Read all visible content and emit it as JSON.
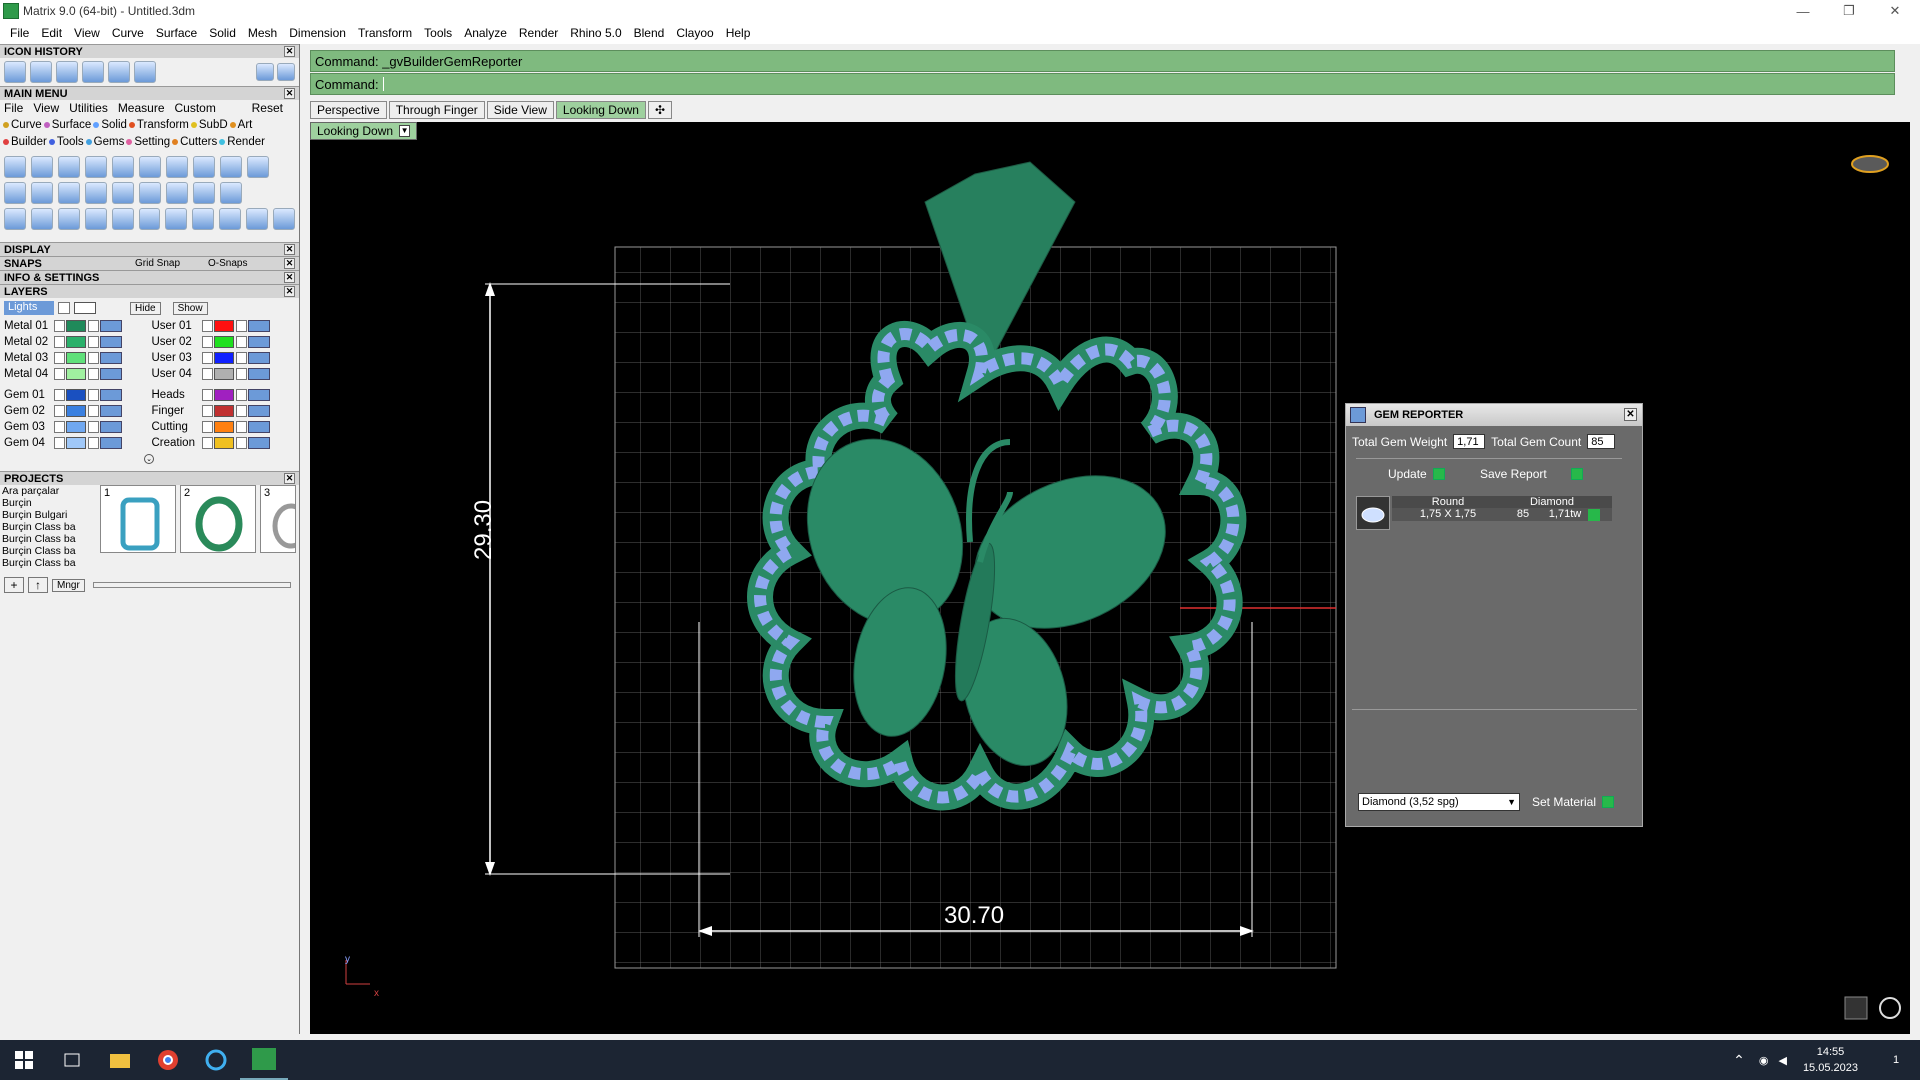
{
  "window": {
    "title": "Matrix 9.0 (64-bit) - Untitled.3dm",
    "min": "—",
    "restore": "❐",
    "close": "✕"
  },
  "menubar": [
    "File",
    "Edit",
    "View",
    "Curve",
    "Surface",
    "Solid",
    "Mesh",
    "Dimension",
    "Transform",
    "Tools",
    "Analyze",
    "Render",
    "Rhino 5.0",
    "Blend",
    "Clayoo",
    "Help"
  ],
  "panels": {
    "icon_history": "ICON HISTORY",
    "main_menu": "MAIN MENU",
    "display": "DISPLAY",
    "snaps": "SNAPS",
    "grid_snap": "Grid Snap",
    "osnaps": "O-Snaps",
    "info": "INFO & SETTINGS",
    "layers": "LAYERS",
    "projects": "PROJECTS"
  },
  "main_menu": {
    "tabs": [
      "File",
      "View",
      "Utilities",
      "Measure",
      "Custom"
    ],
    "reset": "Reset",
    "row1": [
      {
        "label": "Curve",
        "color": "#d0a020"
      },
      {
        "label": "Surface",
        "color": "#c060c0"
      },
      {
        "label": "Solid",
        "color": "#60a0ff"
      },
      {
        "label": "Transform",
        "color": "#e05020"
      },
      {
        "label": "SubD",
        "color": "#e0c020"
      },
      {
        "label": "Art",
        "color": "#e09020"
      }
    ],
    "row2": [
      {
        "label": "Builder",
        "color": "#e04040"
      },
      {
        "label": "Tools",
        "color": "#4060e0"
      },
      {
        "label": "Gems",
        "color": "#40a0e0"
      },
      {
        "label": "Setting",
        "color": "#e060a0"
      },
      {
        "label": "Cutters",
        "color": "#e08020"
      },
      {
        "label": "Render",
        "color": "#40c0e0"
      }
    ]
  },
  "layers": {
    "lights": "Lights",
    "hide": "Hide",
    "show": "Show",
    "left": [
      {
        "name": "Metal 01",
        "color": "#1f8a5a"
      },
      {
        "name": "Metal 02",
        "color": "#2ab06a"
      },
      {
        "name": "Metal 03",
        "color": "#5fe07a"
      },
      {
        "name": "Metal 04",
        "color": "#a0f0a0"
      },
      {
        "name": "Gem 01",
        "color": "#1a50c0"
      },
      {
        "name": "Gem 02",
        "color": "#3a80e0"
      },
      {
        "name": "Gem 03",
        "color": "#70a8f0"
      },
      {
        "name": "Gem 04",
        "color": "#a0c8f8"
      }
    ],
    "right": [
      {
        "name": "User 01",
        "color": "#ff1010"
      },
      {
        "name": "User 02",
        "color": "#20e020"
      },
      {
        "name": "User 03",
        "color": "#1020ff"
      },
      {
        "name": "User 04",
        "color": "#b0b0b0"
      },
      {
        "name": "Heads",
        "color": "#a020c0"
      },
      {
        "name": "Finger",
        "color": "#c03030"
      },
      {
        "name": "Cutting",
        "color": "#ff8010"
      },
      {
        "name": "Creation",
        "color": "#f0c020"
      }
    ]
  },
  "projects": {
    "list": [
      "Ara parçalar",
      "Burçin",
      "Burçin Bulgari",
      "Burçin Class ba",
      "Burçin Class ba",
      "Burçin Class ba",
      "Burçin Class ba"
    ],
    "thumbs": [
      "1",
      "2",
      "3"
    ],
    "mngr": "Mngr",
    "add": "+",
    "up": "↑"
  },
  "command": {
    "line1": "Command: _gvBuilderGemReporter",
    "line2_label": "Command:",
    "line2_value": ""
  },
  "viewtabs": [
    {
      "label": "Perspective",
      "active": false
    },
    {
      "label": "Through Finger",
      "active": false
    },
    {
      "label": "Side View",
      "active": false
    },
    {
      "label": "Looking Down",
      "active": true
    }
  ],
  "viewtab_add": "✣",
  "viewport": {
    "label": "Looking Down",
    "dim_vertical": "29.30",
    "dim_horizontal": "30.70",
    "axis_y": "y",
    "axis_x": "x"
  },
  "gem_reporter": {
    "title": "GEM REPORTER",
    "weight_label": "Total Gem Weight",
    "weight_value": "1,71",
    "count_label": "Total Gem Count",
    "count_value": "85",
    "update": "Update",
    "save_report": "Save Report",
    "table_head": [
      "Round",
      "Diamond"
    ],
    "table_row": {
      "size": "1,75 X 1,75",
      "count": "85",
      "weight": "1,71tw"
    },
    "material_select": "Diamond     (3,52 spg)",
    "set_material": "Set Material"
  },
  "taskbar": {
    "time": "14:55",
    "date": "15.05.2023",
    "notif": "1"
  }
}
